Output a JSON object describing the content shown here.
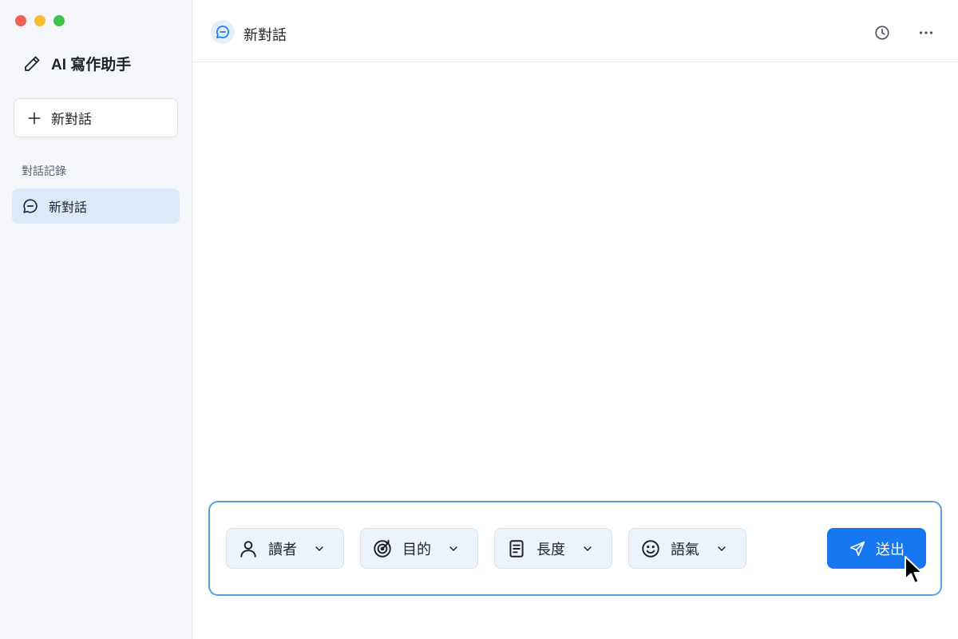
{
  "window": {
    "controls": [
      "close",
      "minimize",
      "zoom"
    ]
  },
  "sidebar": {
    "brand": {
      "icon": "pencil-icon",
      "title": "AI 寫作助手"
    },
    "new_chat": {
      "icon": "plus-icon",
      "label": "新對話"
    },
    "history_label": "對話記錄",
    "history_items": [
      {
        "icon": "chat-bubble-icon",
        "label": "新對話",
        "active": true
      }
    ]
  },
  "header": {
    "icon": "chat-bubble-icon",
    "title": "新對話",
    "actions": [
      {
        "icon": "clock-icon",
        "name": "history"
      },
      {
        "icon": "more-horizontal-icon",
        "name": "more"
      }
    ]
  },
  "composer": {
    "options": [
      {
        "icon": "user-icon",
        "label": "讀者"
      },
      {
        "icon": "target-icon",
        "label": "目的"
      },
      {
        "icon": "document-icon",
        "label": "長度"
      },
      {
        "icon": "smile-icon",
        "label": "語氣"
      }
    ],
    "send": {
      "icon": "send-icon",
      "label": "送出"
    }
  },
  "colors": {
    "accent": "#1677f0",
    "sidebar_bg": "#f4f6f9",
    "active_item_bg": "#dde9f8",
    "option_bg": "#edf3fb",
    "composer_border": "#5a9ee6"
  }
}
